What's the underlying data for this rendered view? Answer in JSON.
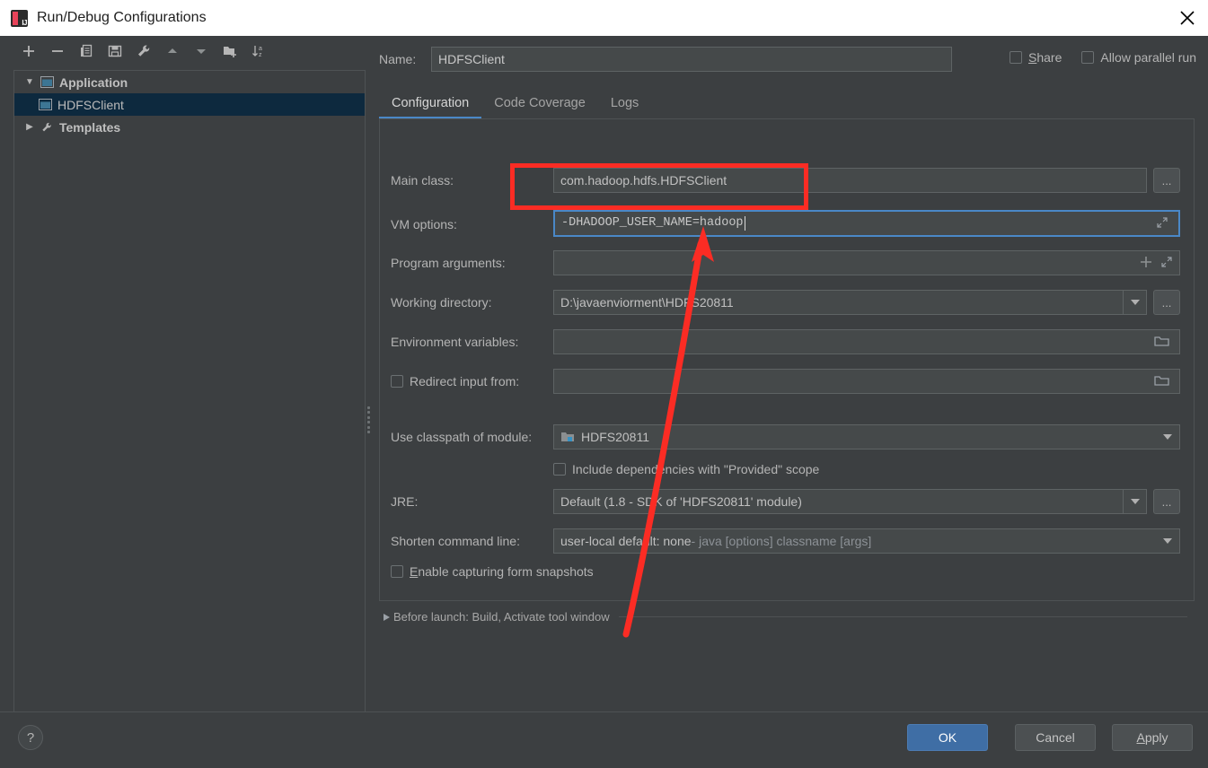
{
  "window": {
    "title": "Run/Debug Configurations",
    "app_icon": "intellij-idea-icon",
    "close_icon": "close-icon"
  },
  "left_panel": {
    "toolbar": [
      {
        "name": "add-button",
        "icon": "plus-icon",
        "label": "+"
      },
      {
        "name": "remove-button",
        "icon": "minus-icon",
        "label": "−"
      },
      {
        "name": "copy-button",
        "icon": "copy-icon",
        "label": "Copy Configuration"
      },
      {
        "name": "save-button",
        "icon": "save-icon",
        "label": "Save Configuration"
      },
      {
        "name": "edit-templates-button",
        "icon": "wrench-icon",
        "label": "Edit Templates"
      },
      {
        "name": "move-up-button",
        "icon": "arrow-up-icon",
        "label": "Move Up"
      },
      {
        "name": "move-down-button",
        "icon": "arrow-down-icon",
        "label": "Move Down"
      },
      {
        "name": "new-folder-button",
        "icon": "folder-add-icon",
        "label": "Create New Folder"
      },
      {
        "name": "sort-button",
        "icon": "sort-az-icon",
        "label": "Sort Configurations"
      }
    ],
    "tree": [
      {
        "label": "Application",
        "icon": "application-icon",
        "expanded": true,
        "selected": false,
        "level": 0,
        "arrow": "▼"
      },
      {
        "label": "HDFSClient",
        "icon": "application-icon",
        "expanded": false,
        "selected": true,
        "level": 1,
        "arrow": ""
      },
      {
        "label": "Templates",
        "icon": "wrench-icon",
        "expanded": false,
        "selected": false,
        "level": 0,
        "arrow": "▶"
      }
    ]
  },
  "header": {
    "name_label": "Name:",
    "name_value": "HDFSClient",
    "name_placeholder": "Name",
    "share_label": "Share",
    "share_checked": false,
    "allow_parallel_label": "Allow parallel run",
    "allow_parallel_checked": false
  },
  "tabs": [
    {
      "label": "Configuration",
      "active": true
    },
    {
      "label": "Code Coverage",
      "active": false
    },
    {
      "label": "Logs",
      "active": false
    }
  ],
  "form": {
    "main_class": {
      "label": "Main class:",
      "value": "com.hadoop.hdfs.HDFSClient",
      "placeholder": "",
      "browse_label": "...",
      "browse_icon": "ellipsis-icon"
    },
    "vm_options": {
      "label": "VM options:",
      "value": "-DHADOOP_USER_NAME=hadoop",
      "placeholder": "",
      "expand_icon": "expand-diagonal-icon",
      "focused": true
    },
    "program_arguments": {
      "label": "Program arguments:",
      "value": "",
      "placeholder": "",
      "insert_icon": "plus-icon",
      "expand_icon": "expand-diagonal-icon"
    },
    "working_directory": {
      "label": "Working directory:",
      "value": "D:\\javaenviorment\\HDFS20811",
      "dropdown_icon": "chevron-down-icon",
      "browse_label": "...",
      "browse_icon": "ellipsis-icon"
    },
    "environment_variables": {
      "label": "Environment variables:",
      "value": "",
      "browse_icon": "folder-icon"
    },
    "redirect_input": {
      "label": "Redirect input from:",
      "checked": false,
      "value": "",
      "browse_icon": "folder-icon"
    },
    "use_classpath_of_module": {
      "label": "Use classpath of module:",
      "value": "HDFS20811",
      "value_icon": "module-icon",
      "dropdown_icon": "chevron-down-icon"
    },
    "include_provided": {
      "label": "Include dependencies with \"Provided\" scope",
      "checked": false
    },
    "jre": {
      "label": "JRE:",
      "value": "Default (1.8 - SDK of 'HDFS20811' module)",
      "dropdown_icon": "chevron-down-icon",
      "browse_label": "...",
      "browse_icon": "ellipsis-icon"
    },
    "shorten_command_line": {
      "label": "Shorten command line:",
      "value_strong": "user-local default: none",
      "value_rest": " - java [options] classname [args]",
      "dropdown_icon": "chevron-down-icon"
    },
    "form_snapshots": {
      "label": "Enable capturing form snapshots",
      "checked": false
    }
  },
  "before_launch": {
    "arrow_icon": "triangle-right-icon",
    "text": "Before launch: Build, Activate tool window"
  },
  "footer": {
    "help_label": "?",
    "help_icon": "help-icon",
    "ok_label": "OK",
    "cancel_label": "Cancel",
    "apply_label": "Apply"
  },
  "annotations": {
    "highlight_color": "#fb2c24",
    "rect_target": "vm-options-input",
    "arrow_target": "vm-options-input"
  },
  "colors": {
    "accent": "#4a88c7",
    "dialog_bg": "#3c3f41",
    "input_bg": "#45494a",
    "selection_bg": "#0d293e",
    "ok_button": "#3f6ea5",
    "annotation_red": "#fb2c24"
  }
}
